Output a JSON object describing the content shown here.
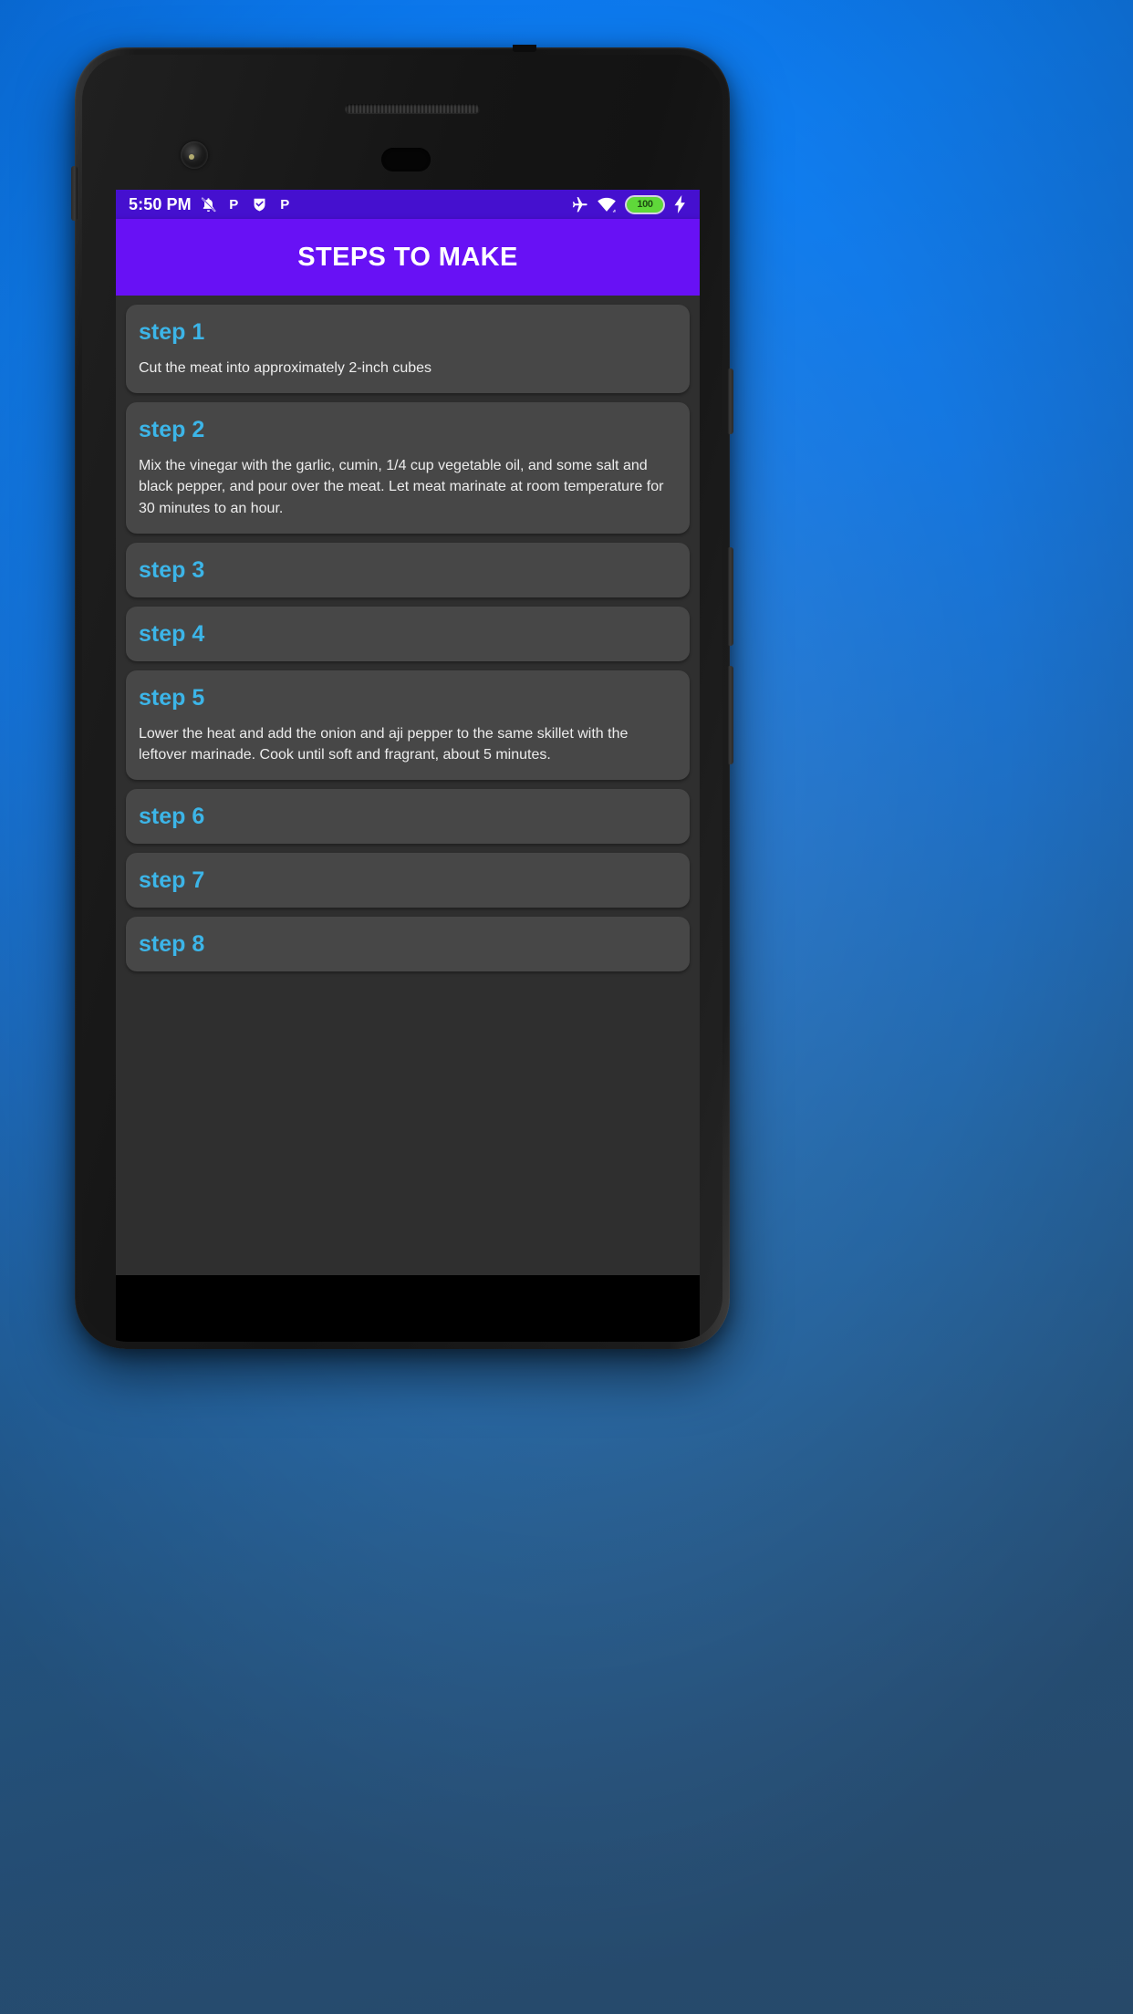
{
  "wallpaper": {
    "gradient_top": "#0a7bf7",
    "gradient_bottom": "#2f5980"
  },
  "device": {
    "name": "android-phone-mockup",
    "body_color": "#1a1a1a"
  },
  "status_bar": {
    "background": "#4510cf",
    "time": "5:50 PM",
    "left_icons": [
      {
        "name": "notifications-muted-icon",
        "glyph": "🔕"
      },
      {
        "name": "app-badge-p-1",
        "glyph": "P"
      },
      {
        "name": "app-badge-shield",
        "glyph": "▼"
      },
      {
        "name": "app-badge-p-2",
        "glyph": "P"
      }
    ],
    "right_icons": [
      {
        "name": "airplane-mode-icon",
        "glyph": "✈"
      },
      {
        "name": "wifi-icon",
        "glyph": "wifi"
      }
    ],
    "battery": {
      "level_text": "100",
      "fill_color": "#5fd83a"
    },
    "charging_icon": "⚡"
  },
  "app_bar": {
    "background": "#6811f5",
    "title": "STEPS TO MAKE"
  },
  "steps_screen": {
    "background": "#2f2f2f",
    "card_background": "#474747",
    "title_color": "#3cb5e8",
    "body_color": "#ececec",
    "steps": [
      {
        "title": "step 1",
        "body": "Cut the meat into approximately 2-inch cubes"
      },
      {
        "title": "step 2",
        "body": "Mix the vinegar with the garlic, cumin, 1/4 cup vegetable oil, and some salt and black pepper, and pour over the meat. Let meat marinate at room temperature for 30 minutes to an hour."
      },
      {
        "title": "step 3",
        "body": ""
      },
      {
        "title": "step 4",
        "body": ""
      },
      {
        "title": "step 5",
        "body": "Lower the heat and add the onion and aji pepper to the same skillet with the leftover marinade. Cook until soft and fragrant, about 5 minutes."
      },
      {
        "title": "step 6",
        "body": ""
      },
      {
        "title": "step 7",
        "body": ""
      },
      {
        "title": "step 8",
        "body": ""
      }
    ]
  }
}
